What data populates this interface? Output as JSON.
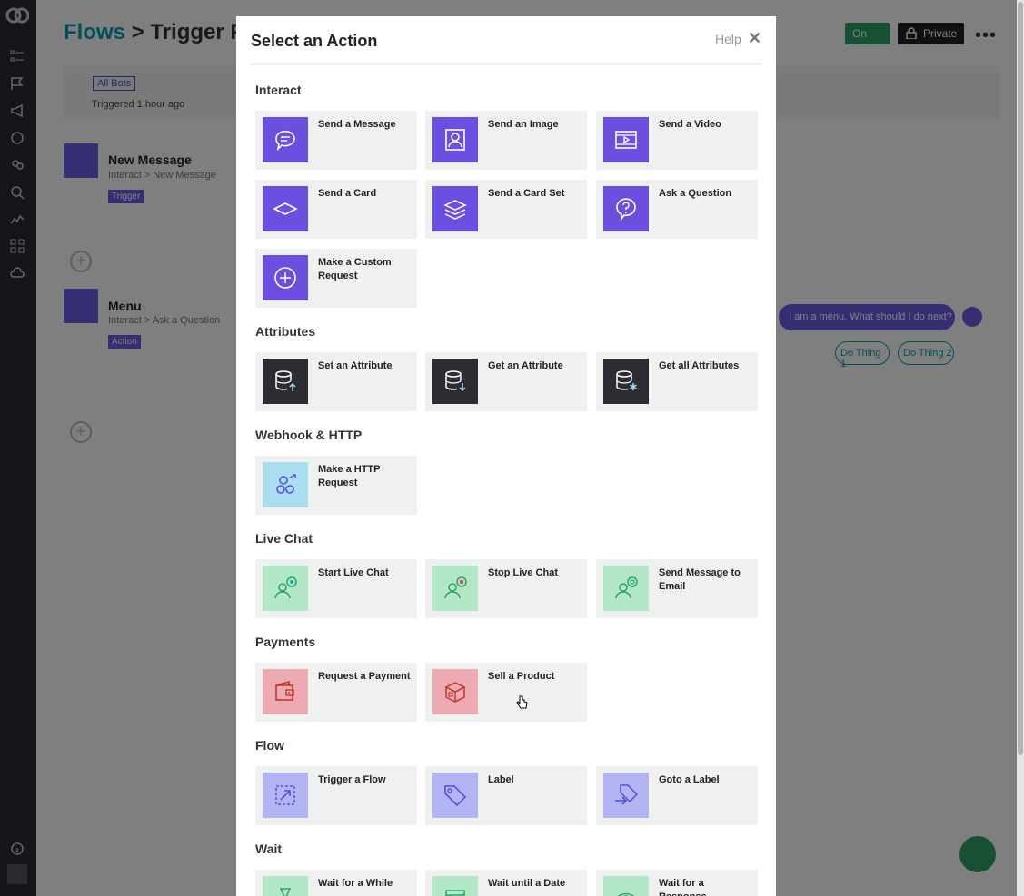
{
  "page": {
    "title_crumb": "Flows",
    "title_sep": ">",
    "title_current": "Trigger Flo",
    "on_label": "On",
    "private_label": "Private",
    "more_label": "•••",
    "all_bots": "All Bots",
    "triggered": "Triggered 1 hour ago",
    "nodes": [
      {
        "title": "New Message",
        "sub": "Interact > New Message",
        "tag": "Trigger"
      },
      {
        "title": "Menu",
        "sub": "Interact > Ask a Question",
        "tag": "Action"
      }
    ],
    "bubble": "I am a menu. What should I do next?",
    "chips": [
      "Do Thing 1",
      "Do Thing 2"
    ]
  },
  "modal": {
    "title": "Select an Action",
    "help": "Help",
    "close": "✕",
    "sections": [
      {
        "title": "Interact",
        "items": [
          "Send a Message",
          "Send an Image",
          "Send a Video",
          "Send a Card",
          "Send a Card Set",
          "Ask a Question",
          "Make a Custom Request"
        ]
      },
      {
        "title": "Attributes",
        "items": [
          "Set an Attribute",
          "Get an Attribute",
          "Get all Attributes"
        ]
      },
      {
        "title": "Webhook & HTTP",
        "items": [
          "Make a HTTP Request"
        ]
      },
      {
        "title": "Live Chat",
        "items": [
          "Start Live Chat",
          "Stop Live Chat",
          "Send Message to Email"
        ]
      },
      {
        "title": "Payments",
        "items": [
          "Request a Payment",
          "Sell a Product"
        ]
      },
      {
        "title": "Flow",
        "items": [
          "Trigger a Flow",
          "Label",
          "Goto a Label"
        ]
      },
      {
        "title": "Wait",
        "items": [
          "Wait for a While",
          "Wait until a Date",
          "Wait for a Response"
        ]
      }
    ]
  },
  "colors": {
    "accent_purple": "#6c4fe0",
    "teal": "#00a0b3",
    "green": "#2ea36b",
    "sidebar": "#2b2d33"
  }
}
